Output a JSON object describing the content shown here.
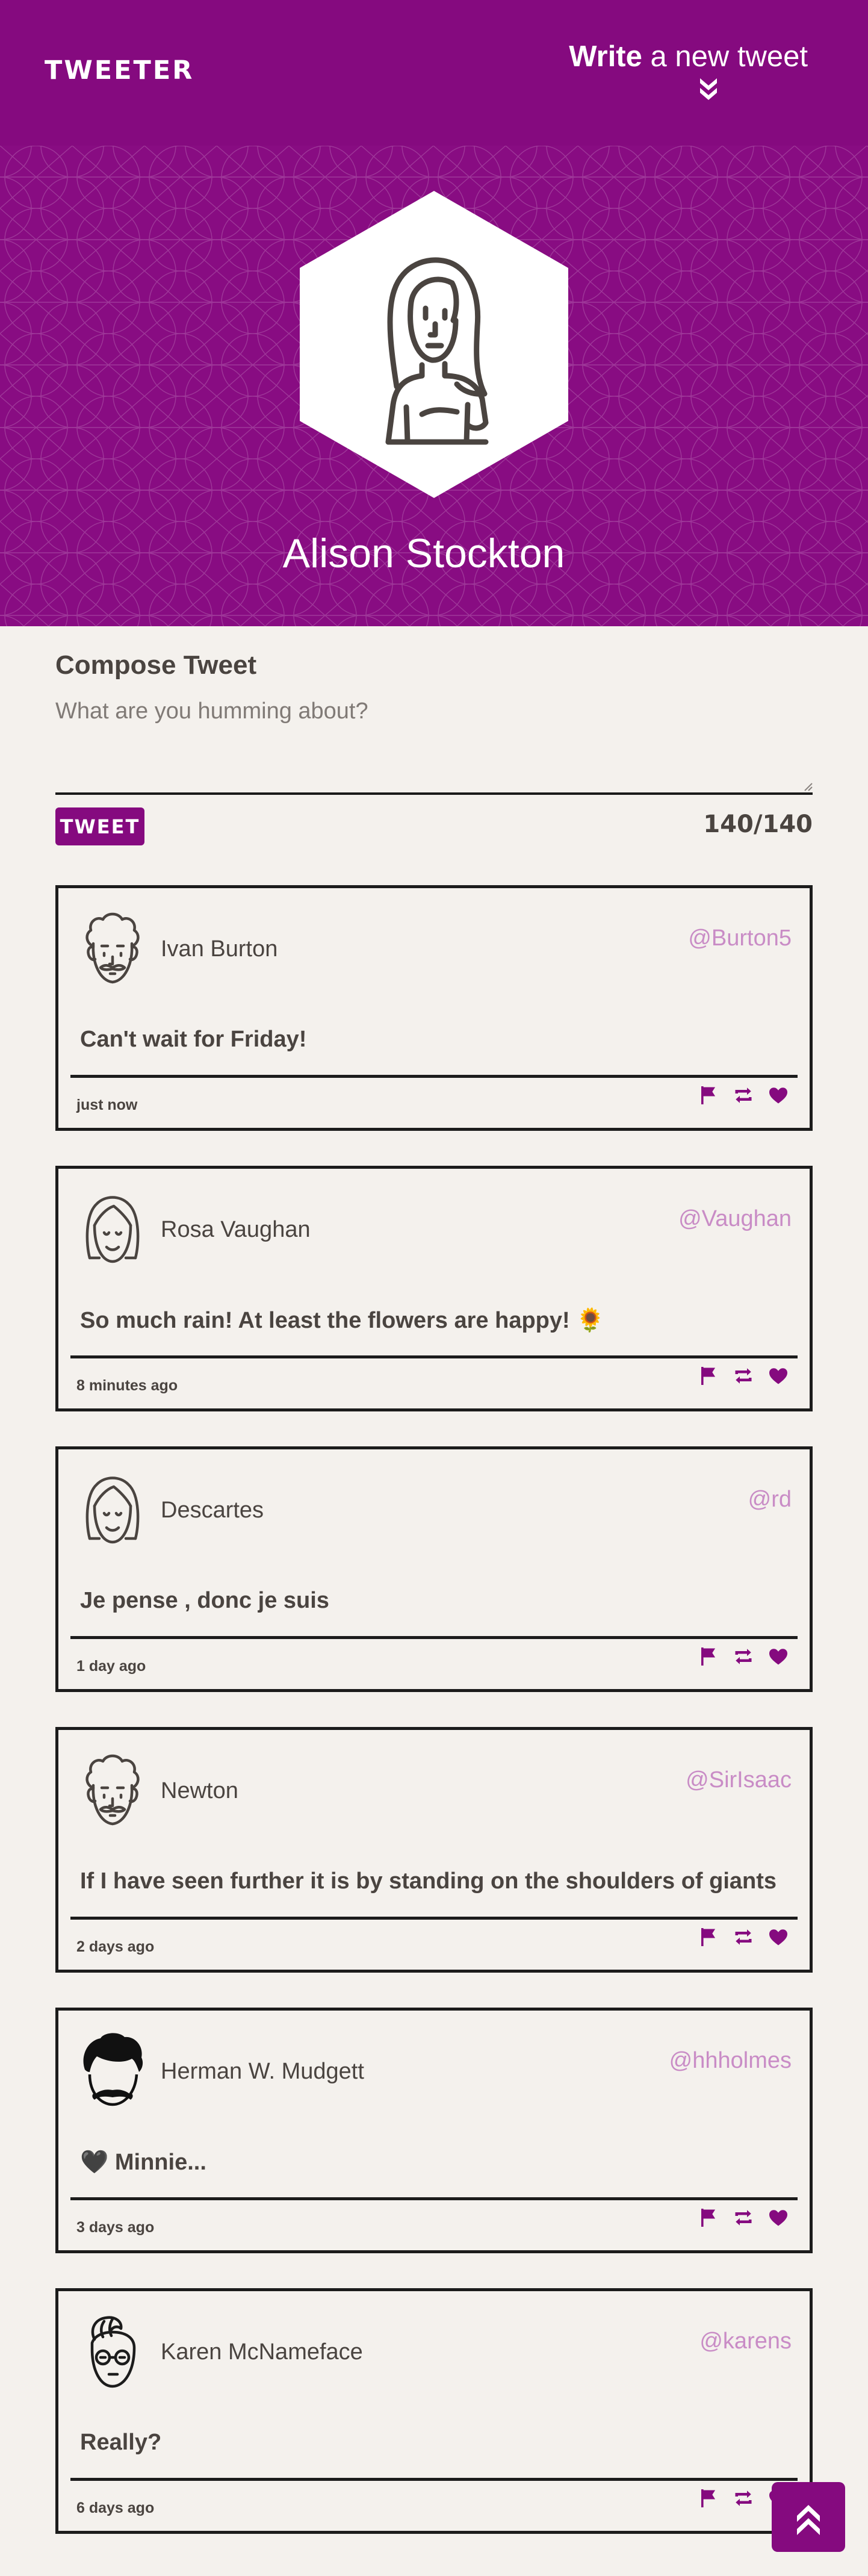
{
  "header": {
    "brand": "TWEETER",
    "write_bold": "Write",
    "write_rest": " a new tweet",
    "write_arrow_icon": "double-chevron-down-icon",
    "background_color": "#850a7f"
  },
  "profile": {
    "name": "Alison Stockton",
    "avatar_icon": "woman-avatar-icon"
  },
  "compose": {
    "title": "Compose Tweet",
    "placeholder": "What are you humming about?",
    "button_label": "TWEET",
    "counter": "140/140"
  },
  "tweets": [
    {
      "name": "Ivan Burton",
      "handle": "@Burton5",
      "text": "Can't wait for Friday!",
      "time": "just now",
      "avatar": "curly-man-avatar-icon"
    },
    {
      "name": "Rosa Vaughan",
      "handle": "@Vaughan",
      "text": "So much rain! At least the flowers are happy! 🌻",
      "time": "8 minutes ago",
      "avatar": "bangs-woman-avatar-icon"
    },
    {
      "name": "Descartes",
      "handle": "@rd",
      "text": "Je pense , donc je suis",
      "time": "1 day ago",
      "avatar": "bangs-woman-avatar-icon"
    },
    {
      "name": "Newton",
      "handle": "@SirIsaac",
      "text": "If I have seen further it is by standing on the shoulders of giants",
      "time": "2 days ago",
      "avatar": "curly-man-avatar-icon"
    },
    {
      "name": "Herman W. Mudgett",
      "handle": "@hhholmes",
      "text": "🖤 Minnie...",
      "time": "3 days ago",
      "avatar": "moustache-man-avatar-icon"
    },
    {
      "name": "Karen McNameface",
      "handle": "@karens",
      "text": "Really?",
      "time": "6 days ago",
      "avatar": "glasses-woman-avatar-icon"
    }
  ],
  "actions": [
    "flag-icon",
    "retweet-icon",
    "heart-icon"
  ],
  "scroll_top_icon": "double-chevron-up-icon",
  "colors": {
    "accent": "#850a7f",
    "handle": "#c98cc6",
    "background": "#f4f1ed",
    "text": "#4a4440"
  }
}
